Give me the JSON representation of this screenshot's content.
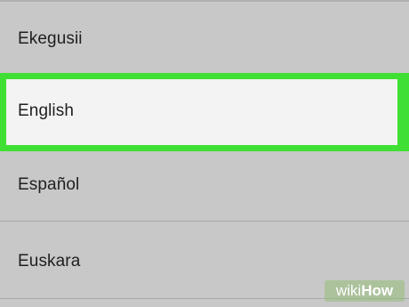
{
  "languages": [
    {
      "label": "Ekegusii",
      "selected": false
    },
    {
      "label": "English",
      "selected": true
    },
    {
      "label": "Español",
      "selected": false
    },
    {
      "label": "Euskara",
      "selected": false
    }
  ],
  "watermark": {
    "prefix": "wiki",
    "suffix": "How"
  },
  "colors": {
    "background": "#c8c8c8",
    "highlight_border": "#3fe033",
    "selected_row": "#f3f3f3"
  }
}
